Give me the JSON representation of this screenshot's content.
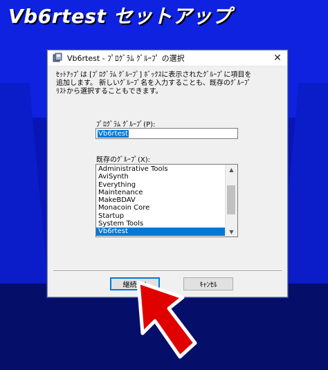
{
  "screen": {
    "title": "Vb6rtest セットアップ"
  },
  "dialog": {
    "title": "Vb6rtest - ﾌﾟﾛｸﾞﾗﾑ ｸﾞﾙｰﾌﾟ の選択",
    "close_symbol": "✕",
    "description_lines": [
      "ｾｯﾄｱｯﾌﾟは [ﾌﾟﾛｸﾞﾗﾑ ｸﾞﾙｰﾌﾟ] ﾎﾞｯｸｽに表示されたｸﾞﾙｰﾌﾟに項目を",
      "追加します。 新しいｸﾞﾙｰﾌﾟ名を入力することも、既存のｸﾞﾙｰﾌﾟ",
      "ﾘｽﾄから選択することもできます。"
    ],
    "group_label": "ﾌﾟﾛｸﾞﾗﾑ ｸﾞﾙｰﾌﾟ(P):",
    "group_value": "Vb6rtest",
    "existing_label": "既存のｸﾞﾙｰﾌﾟ(X):",
    "existing_groups": [
      "Administrative Tools",
      "AviSynth",
      "Everything",
      "Maintenance",
      "MakeBDAV",
      "Monacoin Core",
      "Startup",
      "System Tools",
      "Vb6rtest"
    ],
    "selected_index": 8,
    "continue_label": "継続(C)",
    "cancel_label": "ｷｬﾝｾﾙ"
  },
  "colors": {
    "selection": "#0078d7",
    "arrow_fill": "#e00000",
    "arrow_outline": "#ffffff"
  }
}
